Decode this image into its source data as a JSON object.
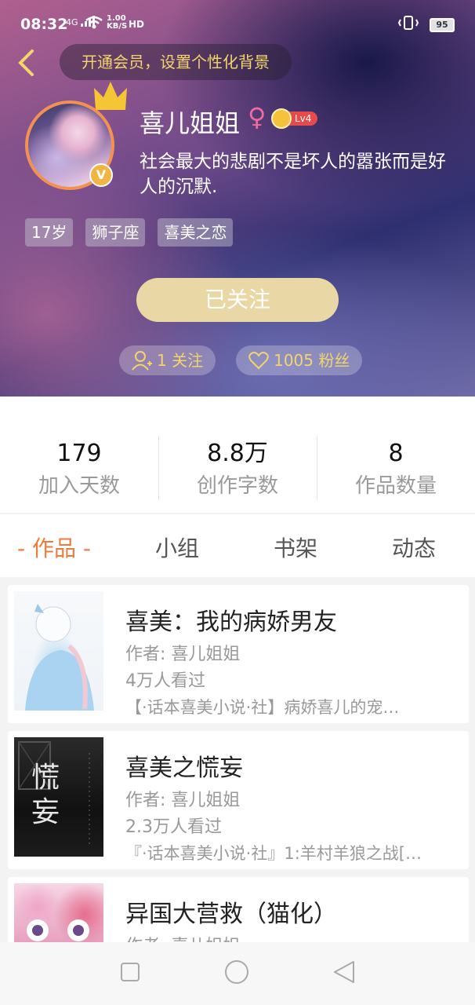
{
  "status_bar": {
    "time": "08:32",
    "network": "4G",
    "speed": "1.00 KB/S",
    "hd": "HD",
    "battery": "95"
  },
  "header": {
    "vip_banner": "开通会员，设置个性化背景",
    "username": "喜儿姐姐",
    "gender_symbol": "♀",
    "level": "Lv4",
    "bio": " 社会最大的悲剧不是坏人的嚣张而是好人的沉默.",
    "tags": [
      "17岁",
      "狮子座",
      "喜美之恋"
    ],
    "follow_button": "已关注",
    "following_count": "1 关注",
    "fans_count": "1005 粉丝",
    "verified_mark": "V"
  },
  "stats": [
    {
      "value": "179",
      "label": "加入天数"
    },
    {
      "value": "8.8万",
      "label": "创作字数"
    },
    {
      "value": "8",
      "label": "作品数量"
    }
  ],
  "tabs": [
    "- 作品 -",
    "小组",
    "书架",
    "动态"
  ],
  "books": [
    {
      "title": "喜美：我的病娇男友",
      "author": "作者: 喜儿姐姐",
      "views": "4万人看过",
      "desc": "【·话本喜美小说·社】病娇喜儿的宠…"
    },
    {
      "title": "喜美之慌妄",
      "author": "作者: 喜儿姐姐",
      "views": "2.3万人看过",
      "desc": "『·话本喜美小说·社』1:羊村羊狼之战[…",
      "cover_text": "慌妄"
    },
    {
      "title": "异国大营救（猫化）",
      "author": "作者: 喜儿姐姐",
      "views": "",
      "desc": ""
    }
  ],
  "colors": {
    "accent_orange": "#f07a3a",
    "gold": "#f3d46d",
    "follow_button_bg": "#e9d7a5"
  }
}
